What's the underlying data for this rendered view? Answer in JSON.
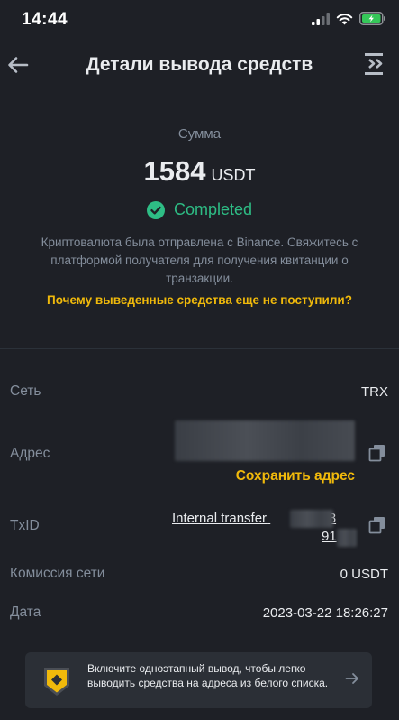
{
  "status_bar": {
    "time": "14:44"
  },
  "header": {
    "title": "Детали вывода средств"
  },
  "summary": {
    "amount_label": "Сумма",
    "amount": "1584",
    "currency": "USDT",
    "status": "Completed",
    "info": "Криптовалюта была отправлена с Binance. Свяжитесь с платформой получателя для получения квитанции о транзакции.",
    "why_link": "Почему выведенные средства еще не поступили?"
  },
  "details": {
    "network_label": "Сеть",
    "network_value": "TRX",
    "address_label": "Адрес",
    "save_address": "Сохранить адрес",
    "txid_label": "TxID",
    "txid_line1_prefix": "Internal transfer",
    "txid_line1_suffix": "98",
    "txid_line2_prefix": "91",
    "fee_label": "Комиссия сети",
    "fee_value": "0 USDT",
    "date_label": "Дата",
    "date_value": "2023-03-22 18:26:27"
  },
  "banner": {
    "text": "Включите одноэтапный вывод, чтобы легко выводить средства на адреса из белого списка."
  },
  "colors": {
    "background": "#1e2026",
    "accent": "#f0b90b",
    "success": "#2ebd85",
    "muted": "#848e9c"
  },
  "icons": [
    "back-arrow-icon",
    "export-icon",
    "check-circle-icon",
    "copy-icon",
    "shield-icon",
    "arrow-right-icon"
  ]
}
